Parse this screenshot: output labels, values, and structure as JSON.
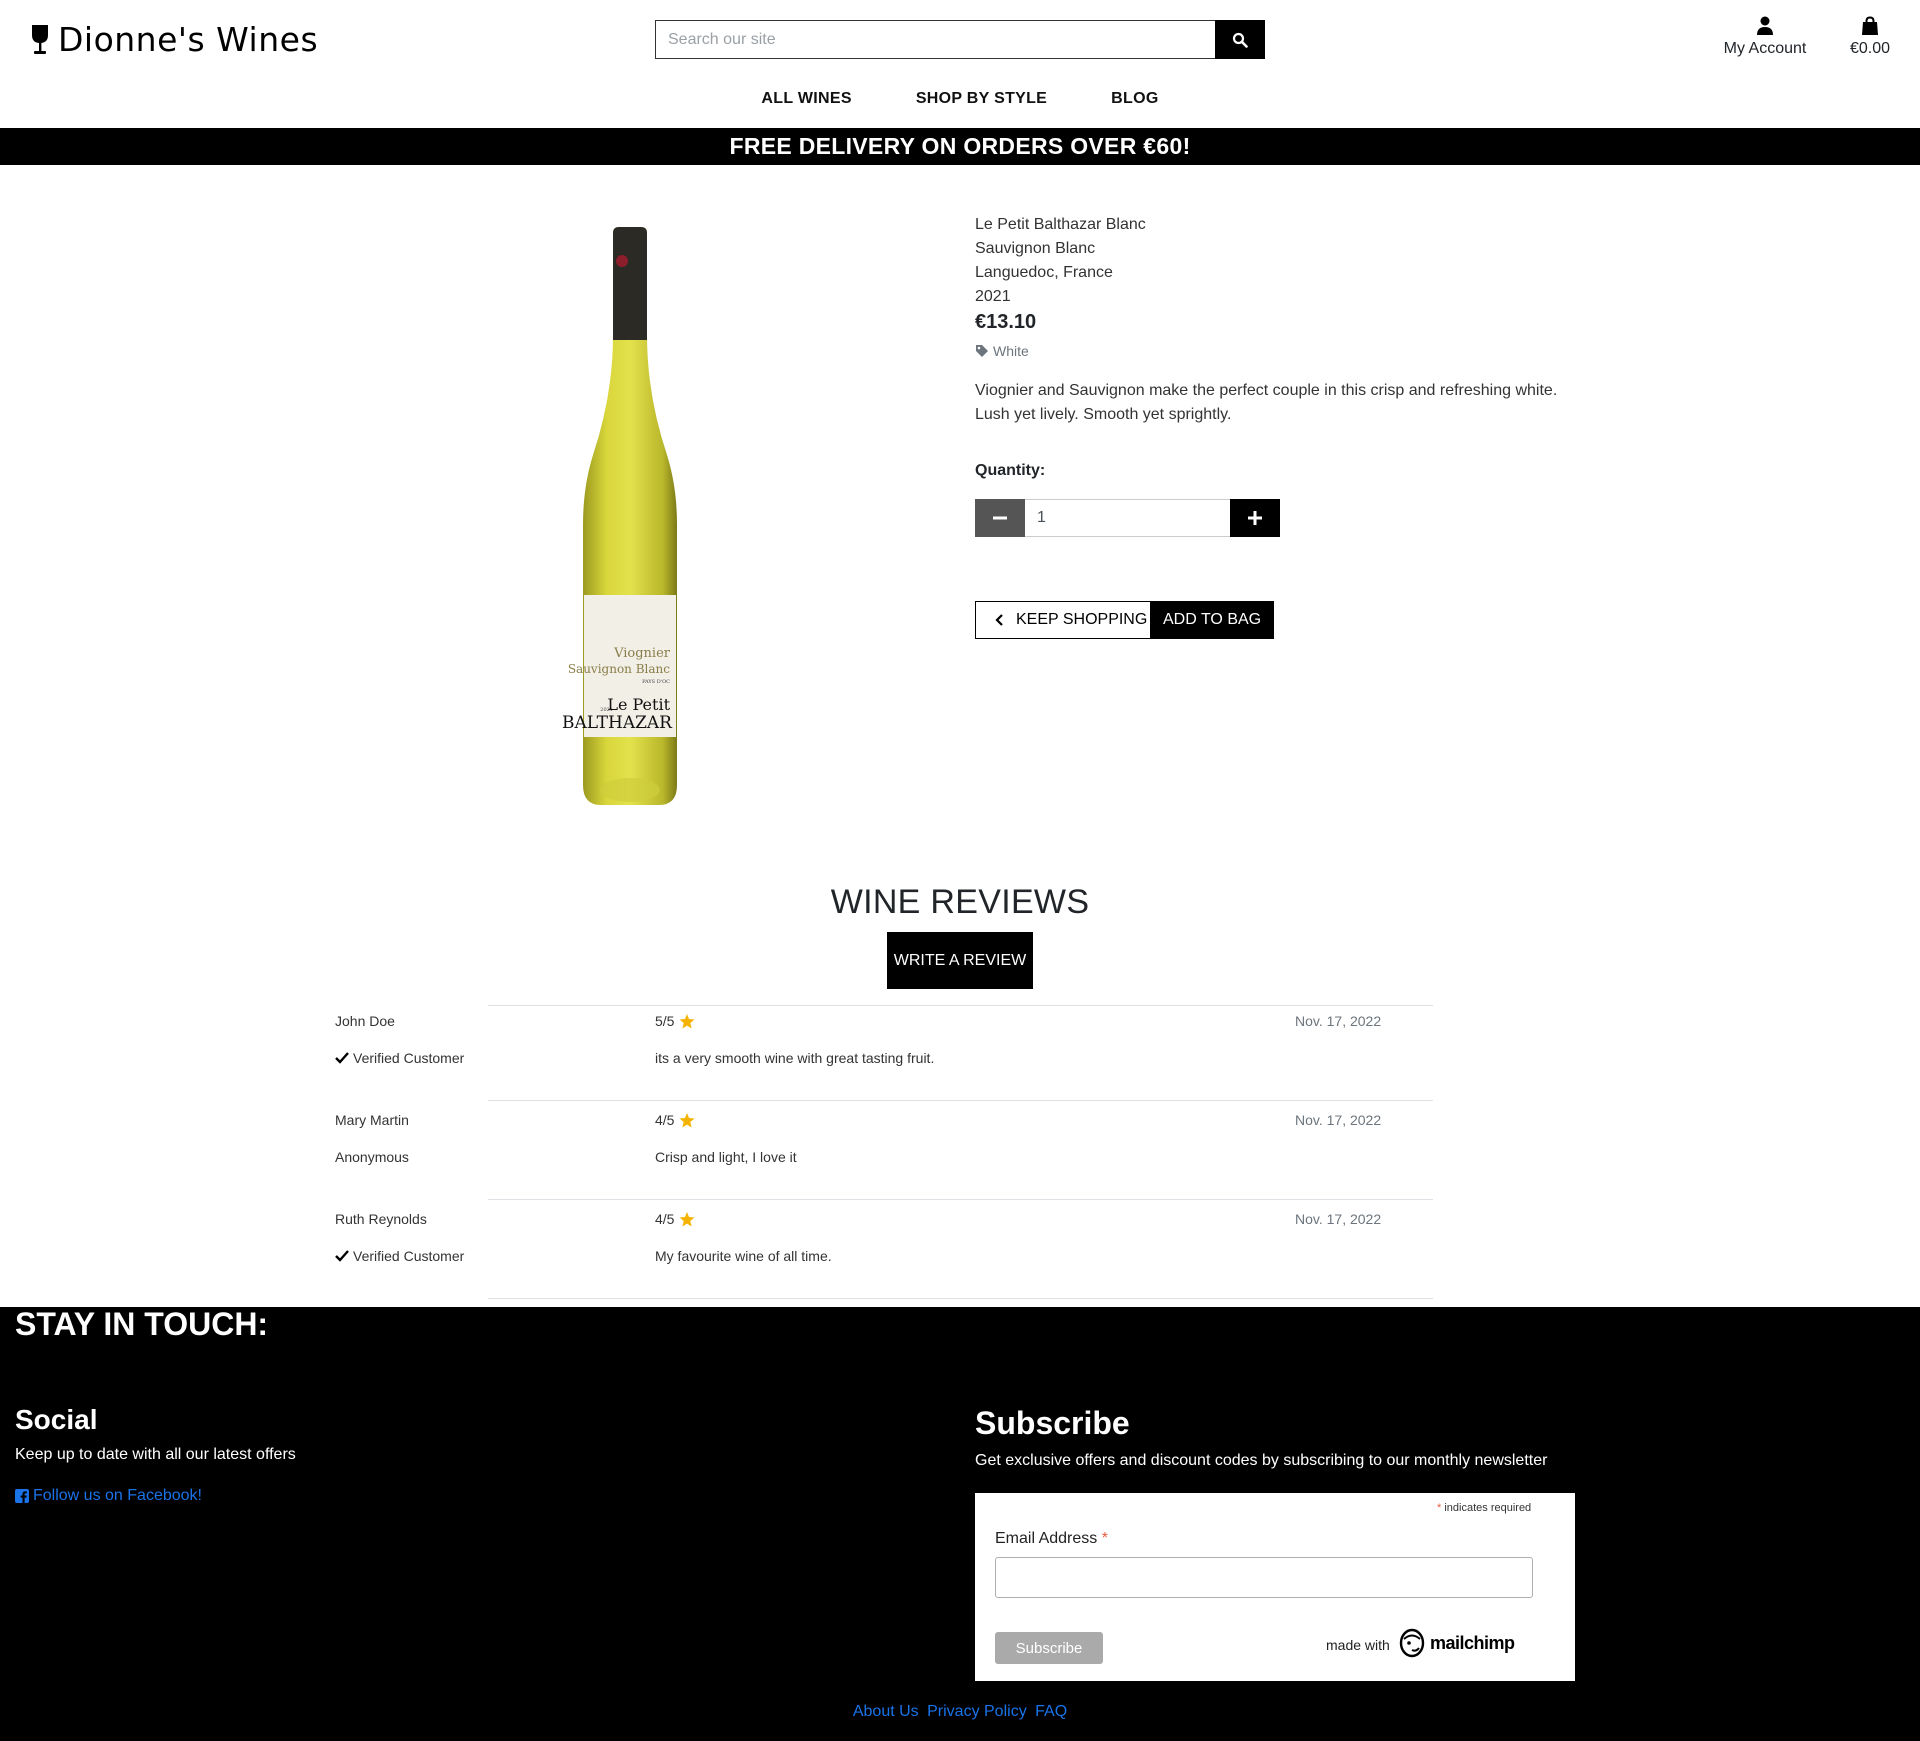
{
  "header": {
    "logo_text": "Dionne's Wines",
    "search_placeholder": "Search our site",
    "account_label": "My Account",
    "bag_total": "€0.00"
  },
  "nav": {
    "items": [
      "ALL WINES",
      "SHOP BY STYLE",
      "BLOG"
    ]
  },
  "banner": "FREE DELIVERY ON ORDERS OVER €60!",
  "product": {
    "name": "Le Petit Balthazar Blanc",
    "grape": "Sauvignon Blanc",
    "region": "Languedoc, France",
    "year": "2021",
    "price": "€13.10",
    "category": "White",
    "description_line1": "Viognier and Sauvignon make the perfect couple in this crisp and refreshing white.",
    "description_line2": "Lush yet lively. Smooth yet sprightly.",
    "quantity_label": "Quantity:",
    "quantity_value": "1",
    "keep_shopping": "KEEP SHOPPING",
    "add_to_bag": "ADD TO BAG",
    "label_art": {
      "line1": "Viognier",
      "line2": "Sauvignon Blanc",
      "line3": "PAYS D'OC",
      "year": "2021",
      "brand1": "Le Petit",
      "brand2": "BALTHAZAR"
    }
  },
  "reviews": {
    "title": "WINE REVIEWS",
    "write_button": "WRITE A REVIEW",
    "items": [
      {
        "name": "John Doe",
        "status": "Verified Customer",
        "verified": true,
        "score": "5/5",
        "date": "Nov. 17, 2022",
        "text": "its a very smooth wine with great tasting fruit."
      },
      {
        "name": "Mary Martin",
        "status": "Anonymous",
        "verified": false,
        "score": "4/5",
        "date": "Nov. 17, 2022",
        "text": "Crisp and light, I love it"
      },
      {
        "name": "Ruth Reynolds",
        "status": "Verified Customer",
        "verified": true,
        "score": "4/5",
        "date": "Nov. 17, 2022",
        "text": "My favourite wine of all time."
      }
    ]
  },
  "footer": {
    "title": "STAY IN TOUCH:",
    "social_heading": "Social",
    "social_sub": "Keep up to date with all our latest offers",
    "facebook_link": "Follow us on Facebook!",
    "subscribe_heading": "Subscribe",
    "subscribe_sub": "Get exclusive offers and discount codes by subscribing to our monthly newsletter",
    "required_note": "indicates required",
    "email_label": "Email Address",
    "subscribe_button": "Subscribe",
    "made_with": "made with",
    "mailchimp": "mailchimp",
    "links": [
      "About Us",
      "Privacy Policy",
      "FAQ"
    ]
  },
  "colors": {
    "accent": "#000000",
    "link": "#1a73e8",
    "star": "#f5b301",
    "required": "#e85c41"
  }
}
